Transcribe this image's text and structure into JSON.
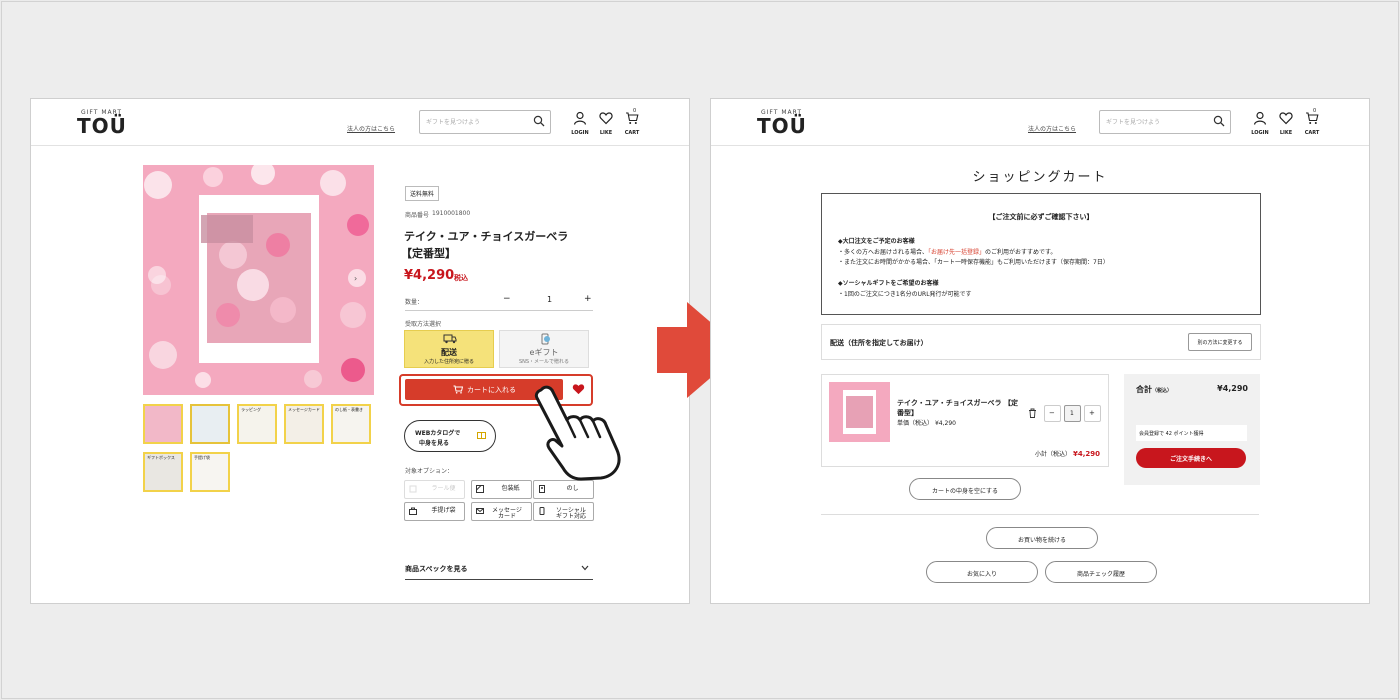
{
  "brand": {
    "sub": "GIFT MART",
    "name": "TOÜ"
  },
  "header": {
    "corp_link": "法人の方はこちら",
    "search_placeholder": "ギフトを見つけよう",
    "login": "LOGIN",
    "like": "LIKE",
    "cart": "CART",
    "cart_count": "0"
  },
  "product": {
    "free_shipping": "送料無料",
    "number_label": "商品番号",
    "number": "1910001800",
    "title_line1": "テイク・ユア・チョイスガーベラ",
    "title_line2": "【定番型】",
    "price": "¥4,290",
    "price_tax": "税込",
    "qty_label": "数量：",
    "qty_minus": "−",
    "qty_value": "1",
    "qty_plus": "+",
    "receive_label": "受取方法選択",
    "delivery_title": "配送",
    "delivery_sub": "入力した住所宛に贈る",
    "egift_title": "eギフト",
    "egift_sub": "SNS・メールで贈れる",
    "add_to_cart": "カートに入れる",
    "web_catalog_line1": "WEBカタログで",
    "web_catalog_line2": "中身を見る",
    "options_label": "対象オプション：",
    "options": [
      {
        "label": "ラール便",
        "icon": "noshi-disabled-icon"
      },
      {
        "label": "包装紙",
        "icon": "wrapping-icon"
      },
      {
        "label": "のし",
        "icon": "noshi-icon"
      },
      {
        "label": "手提げ袋",
        "icon": "bag-icon"
      },
      {
        "label": "メッセージカード",
        "icon": "message-card-icon"
      },
      {
        "label": "ソーシャルギフト対応",
        "icon": "phone-icon"
      }
    ],
    "spec_link": "商品スペックを見る",
    "thumbnails": [
      {
        "label": ""
      },
      {
        "label": ""
      },
      {
        "label": "ラッピング"
      },
      {
        "label": "メッセージカード"
      },
      {
        "label": "のし紙・表書き"
      },
      {
        "label": "ギフトボックス"
      },
      {
        "label": "手提げ袋"
      }
    ]
  },
  "cart": {
    "title": "ショッピングカート",
    "notice_title": "【ご注文前に必ずご確認下さい】",
    "notice1_head": "◆大口注文をご予定のお客様",
    "notice1_l1_pre": "・多くの方へお届けされる場合、",
    "notice1_l1_link": "「お届け先一括登録」",
    "notice1_l1_post": "のご利用がおすすめです。",
    "notice1_l2": "・また注文にお時間がかかる場合、「カート一時保存機能」もご利用いただけます（保存期間：7日）",
    "notice2_head": "◆ソーシャルギフトをご希望のお客様",
    "notice2_l1": "・1回のご注文につき1名分のURL発行が可能です",
    "ship_label": "配送（住所を指定してお届け）",
    "change_method": "別の方法に変更する",
    "item_title_line1": "テイク・ユア・チョイスガーベラ 【定",
    "item_title_line2": "番型】",
    "unit_price_label": "単価",
    "unit_price_tax": "（税込）",
    "unit_price": "¥4,290",
    "qty_minus": "−",
    "qty_value": "1",
    "qty_plus": "+",
    "subtotal_label": "小計",
    "subtotal_tax": "（税込）",
    "subtotal": "¥4,290",
    "total_label": "合計",
    "total_tax": "（税込）",
    "total": "¥4,290",
    "points": "会員登録で 42 ポイント獲得",
    "checkout": "ご注文手続きへ",
    "empty_cart": "カートの中身を空にする",
    "continue": "お買い物を続ける",
    "favorites": "お気に入り",
    "history": "商品チェック履歴"
  },
  "colors": {
    "accent": "#d63c2a",
    "yellow": "#f5e27a",
    "price_red": "#c8161d",
    "arrow": "#e04a3a"
  }
}
